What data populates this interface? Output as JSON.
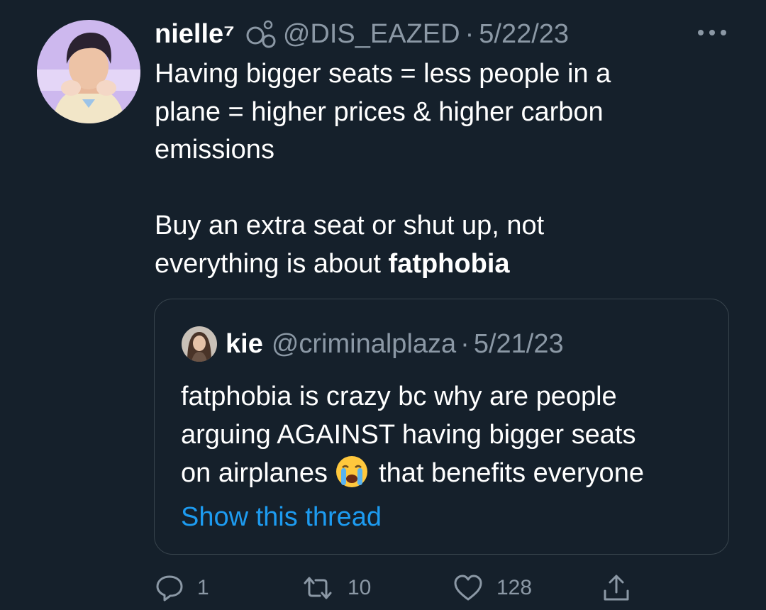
{
  "tweet": {
    "author_name": "nielle⁷",
    "author_handle": "@DIS_EAZED",
    "separator": "·",
    "date": "5/22/23",
    "body": {
      "line1": "Having bigger seats = less people in a",
      "line2": "plane = higher prices & higher carbon",
      "line3": "emissions",
      "line4": "Buy an extra seat or shut up, not",
      "line5_prefix": "everything is about ",
      "line5_hashtag": "fatphobia"
    }
  },
  "quoted_tweet": {
    "author_name": "kie",
    "author_handle": "@criminalplaza",
    "separator": "·",
    "date": "5/21/23",
    "body": {
      "line1": "fatphobia is crazy bc why are people",
      "line2": "arguing AGAINST having bigger seats",
      "line3_prefix": "on airplanes",
      "line3_suffix": "that benefits everyone"
    },
    "show_thread_label": "Show this thread"
  },
  "actions": {
    "reply_count": "1",
    "retweet_count": "10",
    "like_count": "128"
  },
  "icons": {
    "more": "more-horizontal-icon",
    "reply": "reply-icon",
    "retweet": "retweet-icon",
    "like": "heart-icon",
    "share": "share-icon",
    "name_emoji": "bubbles-icon",
    "quote_emoji": "loudly-crying-face-icon"
  },
  "colors": {
    "background": "#15202b",
    "text": "#ffffff",
    "secondary": "#8b98a5",
    "link": "#1d9bf0",
    "border": "#38444d"
  }
}
